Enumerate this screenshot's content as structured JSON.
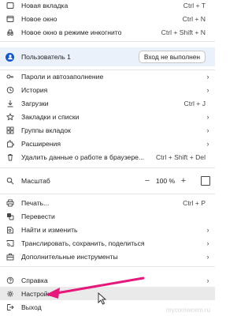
{
  "menu": {
    "new_tab": {
      "label": "Новая вкладка",
      "shortcut": "Ctrl + T"
    },
    "new_window": {
      "label": "Новое окно",
      "shortcut": "Ctrl + N"
    },
    "incognito": {
      "label": "Новое окно в режиме инкогнито",
      "shortcut": "Ctrl + Shift + N"
    },
    "profile": {
      "name": "Пользователь 1",
      "signin": "Вход не выполнен"
    },
    "passwords": {
      "label": "Пароли и автозаполнение"
    },
    "history": {
      "label": "История"
    },
    "downloads": {
      "label": "Загрузки",
      "shortcut": "Ctrl + J"
    },
    "bookmarks": {
      "label": "Закладки и списки"
    },
    "tab_groups": {
      "label": "Группы вкладок"
    },
    "extensions": {
      "label": "Расширения"
    },
    "clear_data": {
      "label": "Удалить данные о работе в браузере...",
      "shortcut": "Ctrl + Shift + Del"
    },
    "zoom": {
      "label": "Масштаб",
      "minus": "−",
      "value": "100 %",
      "plus": "+"
    },
    "print": {
      "label": "Печать...",
      "shortcut": "Ctrl + P"
    },
    "translate": {
      "label": "Перевести"
    },
    "find": {
      "label": "Найти и изменить"
    },
    "cast": {
      "label": "Транслировать, сохранить, поделиться"
    },
    "more_tools": {
      "label": "Дополнительные инструменты"
    },
    "help": {
      "label": "Справка"
    },
    "settings": {
      "label": "Настройки"
    },
    "exit": {
      "label": "Выход"
    }
  },
  "watermark": "mycomwcem.ru",
  "colors": {
    "accent": "#0b57d0",
    "annotation_arrow": "#e8177a",
    "profile_bg": "#eaf1fb"
  }
}
